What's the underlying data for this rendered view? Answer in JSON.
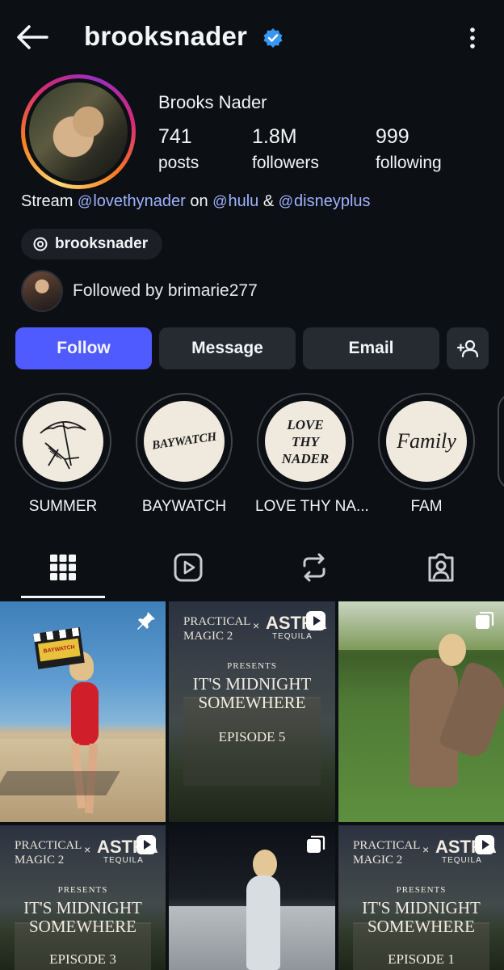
{
  "header": {
    "handle": "brooksnader",
    "verified": true,
    "back_icon": "arrow-left-icon",
    "more_icon": "more-vertical-icon"
  },
  "profile": {
    "display_name": "Brooks Nader",
    "stats": [
      {
        "value": "741",
        "label": "posts"
      },
      {
        "value": "1.8M",
        "label": "followers"
      },
      {
        "value": "999",
        "label": "following"
      }
    ],
    "bio": {
      "prefix": "Stream ",
      "mention1": "lovethynader",
      "mid1": " on ",
      "mention2": "hulu",
      "mid2": " & ",
      "mention3": "disneyplus"
    },
    "threads_handle": "brooksnader",
    "followed_by": "Followed by brimarie277"
  },
  "actions": {
    "follow": "Follow",
    "message": "Message",
    "email": "Email",
    "add_person_icon": "person-add-icon"
  },
  "highlights": [
    {
      "label": "SUMMER",
      "cover_text": ""
    },
    {
      "label": "BAYWATCH",
      "cover_text": "BAYWATCH"
    },
    {
      "label": "LOVE THY NA...",
      "cover_text": "LOVE THY NADER"
    },
    {
      "label": "FAM",
      "cover_text": "Family"
    }
  ],
  "tabs": [
    {
      "name": "grid",
      "icon": "grid-icon",
      "active": true
    },
    {
      "name": "reels",
      "icon": "reels-icon",
      "active": false
    },
    {
      "name": "reposts",
      "icon": "repost-icon",
      "active": false
    },
    {
      "name": "tagged",
      "icon": "tagged-icon",
      "active": false
    }
  ],
  "posts": [
    {
      "kind": "photo",
      "badge": "pin-icon",
      "clapper_text": "BAYWATCH"
    },
    {
      "kind": "promo",
      "badge": "reel-icon",
      "brand_left": "PRACTICAL MAGIC 2",
      "x": "×",
      "brand_right": "ASTRA",
      "brand_sub": "TEQUILA",
      "presents": "PRESENTS",
      "title1": "IT'S MIDNIGHT",
      "title2": "SOMEWHERE",
      "episode": "EPISODE 5"
    },
    {
      "kind": "photo",
      "badge": "carousel-icon"
    },
    {
      "kind": "promo",
      "badge": "reel-icon",
      "brand_left": "PRACTICAL MAGIC 2",
      "x": "×",
      "brand_right": "ASTRA",
      "brand_sub": "TEQUILA",
      "presents": "PRESENTS",
      "title1": "IT'S MIDNIGHT",
      "title2": "SOMEWHERE",
      "episode": "EPISODE 3"
    },
    {
      "kind": "photo",
      "badge": "carousel-icon"
    },
    {
      "kind": "promo",
      "badge": "reel-icon",
      "brand_left": "PRACTICAL MAGIC 2",
      "x": "×",
      "brand_right": "ASTRA",
      "brand_sub": "TEQUILA",
      "presents": "PRESENTS",
      "title1": "IT'S MIDNIGHT",
      "title2": "SOMEWHERE",
      "episode": "EPISODE 1"
    }
  ],
  "colors": {
    "background": "#0c0f14",
    "primary": "#4f5bff",
    "secondary_button": "#262a31",
    "mention": "#9fb3ff",
    "verified": "#3897f0"
  }
}
